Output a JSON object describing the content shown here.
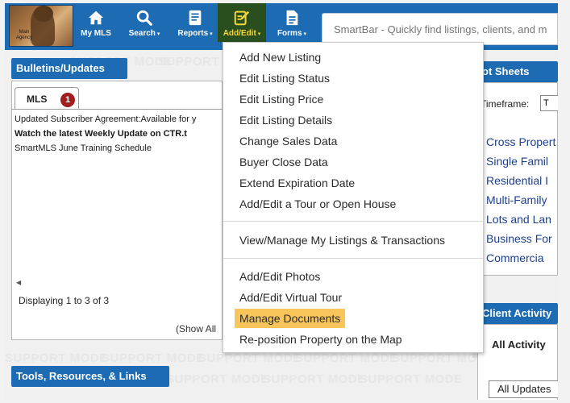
{
  "watermark": "SUPPORT MODE",
  "logo": {
    "agency_label": "Main Agency"
  },
  "nav": {
    "my_mls": "My MLS",
    "search": "Search",
    "reports": "Reports",
    "add_edit": "Add/Edit",
    "forms": "Forms",
    "caret": "▾"
  },
  "smartbar": {
    "placeholder": "SmartBar - Quickly find listings, clients, and m"
  },
  "bulletins": {
    "title": "Bulletins/Updates",
    "tab_label": "MLS",
    "tab_badge": "1",
    "items": [
      "Updated Subscriber Agreement:Available for y",
      "Watch the latest Weekly Update on CTR.t",
      "SmartMLS June Training Schedule"
    ],
    "display_count": "Displaying 1 to 3 of 3",
    "show_all": "(Show All"
  },
  "tools": {
    "title": "Tools, Resources, & Links"
  },
  "hotsheets": {
    "title": "ot Sheets",
    "timeframe_label": "Timeframe:",
    "timeframe_value": "T",
    "links": [
      "Cross Propert",
      "Single Famil",
      "Residential I",
      "Multi-Family",
      "Lots and Lan",
      "Business For",
      "Commercia"
    ]
  },
  "client_activity": {
    "title": "Client Activity",
    "all_activity": "All Activity",
    "all_updates": "All Updates"
  },
  "dropdown": {
    "group1": [
      "Add New Listing",
      "Edit Listing Status",
      "Edit Listing Price",
      "Edit Listing Details",
      "Change Sales Data",
      "Buyer Close Data",
      "Extend Expiration Date",
      "Add/Edit a Tour or Open House"
    ],
    "group2": [
      "View/Manage My Listings & Transactions"
    ],
    "group3": [
      "Add/Edit Photos",
      "Add/Edit Virtual Tour",
      "Manage Documents",
      "Re-position Property on the Map"
    ],
    "highlighted": "Manage Documents"
  },
  "colors": {
    "nav_blue": "#1d6cb3",
    "active_nav_bg": "#2a4f1e",
    "active_nav_text": "#f5d63a",
    "highlight": "#f8c55a",
    "link_blue": "#1c3f8f",
    "badge_red": "#a21d1d"
  },
  "icons": {
    "my_mls": "home-icon",
    "search": "search-icon",
    "reports": "report-icon",
    "add_edit": "edit-icon",
    "forms": "document-icon"
  }
}
